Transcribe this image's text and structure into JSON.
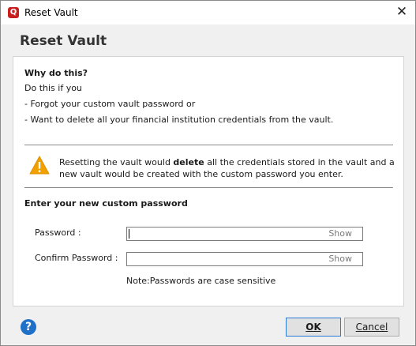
{
  "window": {
    "title": "Reset Vault",
    "app_icon_letter": "Q"
  },
  "heading": "Reset Vault",
  "why": {
    "title": "Why do this?",
    "intro": "Do this if you",
    "items": [
      "- Forgot your custom vault password or",
      "- Want to delete all your financial institution credentials from the vault."
    ]
  },
  "warning": {
    "before": "Resetting the vault would ",
    "bold": "delete",
    "after": " all the credentials stored in the vault and a new vault would be created with the custom password you enter.",
    "color": "#f0a000"
  },
  "form": {
    "title": "Enter your new custom password",
    "password_label": "Password :",
    "confirm_label": "Confirm Password :",
    "show_label": "Show",
    "password_value": "",
    "confirm_value": "",
    "note": "Note:Passwords are case sensitive"
  },
  "buttons": {
    "ok": "OK",
    "cancel": "Cancel",
    "help": "?"
  },
  "colors": {
    "accent": "#2a7bd6",
    "brand": "#c8201e"
  }
}
